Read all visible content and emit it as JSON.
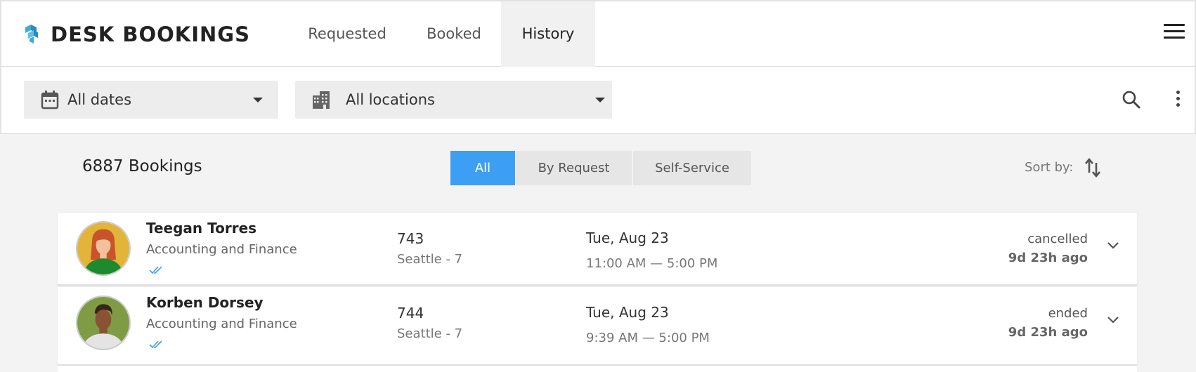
{
  "app": {
    "title": "DESK BOOKINGS"
  },
  "tabs": [
    {
      "label": "Requested",
      "active": false
    },
    {
      "label": "Booked",
      "active": false
    },
    {
      "label": "History",
      "active": true
    }
  ],
  "filters": {
    "dates": "All dates",
    "locations": "All locations"
  },
  "summary": {
    "count": "6887 Bookings"
  },
  "segments": [
    {
      "label": "All",
      "active": true
    },
    {
      "label": "By Request",
      "active": false
    },
    {
      "label": "Self-Service",
      "active": false
    }
  ],
  "sort": {
    "label": "Sort by:"
  },
  "colors": {
    "accent": "#3d9ff3",
    "check": "#3d9ff3"
  },
  "bookings": [
    {
      "name": "Teegan Torres",
      "department": "Accounting and Finance",
      "desk": "743",
      "location": "Seattle - 7",
      "date": "Tue, Aug 23",
      "time": "11:00 AM — 5:00 PM",
      "status": "cancelled",
      "ago": "9d 23h ago"
    },
    {
      "name": "Korben Dorsey",
      "department": "Accounting and Finance",
      "desk": "744",
      "location": "Seattle - 7",
      "date": "Tue, Aug 23",
      "time": "9:39 AM — 5:00 PM",
      "status": "ended",
      "ago": "9d 23h ago"
    }
  ]
}
